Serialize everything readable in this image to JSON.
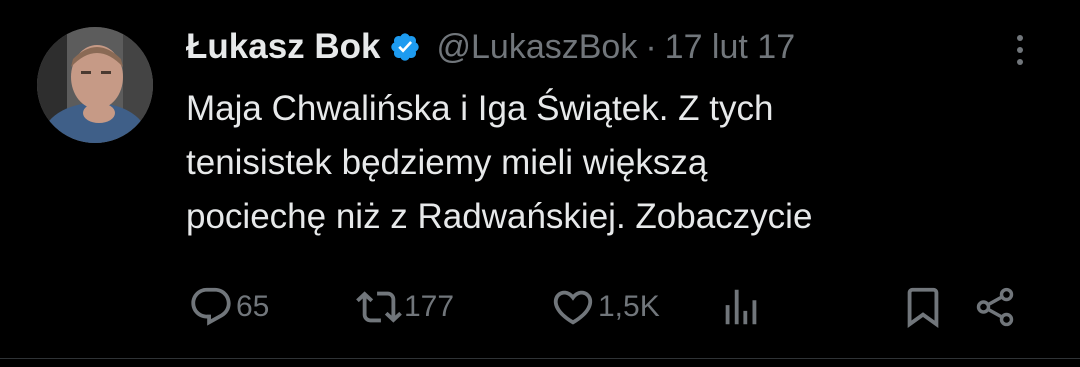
{
  "colors": {
    "background": "#000000",
    "text": "#e7e9ea",
    "secondary": "#71767b",
    "verified": "#1d9bf0",
    "divider": "#2f3336"
  },
  "author": {
    "name": "Łukasz Bok",
    "handle": "@LukaszBok",
    "separator": "·",
    "date": "17 lut 17",
    "verified_icon": "verified-badge-icon"
  },
  "tweet": {
    "lines": [
      "Maja Chwalińska i Iga Świątek. Z tych",
      "tenisistek będziemy mieli większą",
      "pociechę niż z Radwańskiej. Zobaczycie"
    ]
  },
  "actions": {
    "reply_count": "65",
    "retweet_count": "177",
    "like_count": "1,5K",
    "icons": [
      "reply-icon",
      "retweet-icon",
      "like-icon",
      "views-icon",
      "bookmark-icon",
      "share-icon"
    ]
  }
}
